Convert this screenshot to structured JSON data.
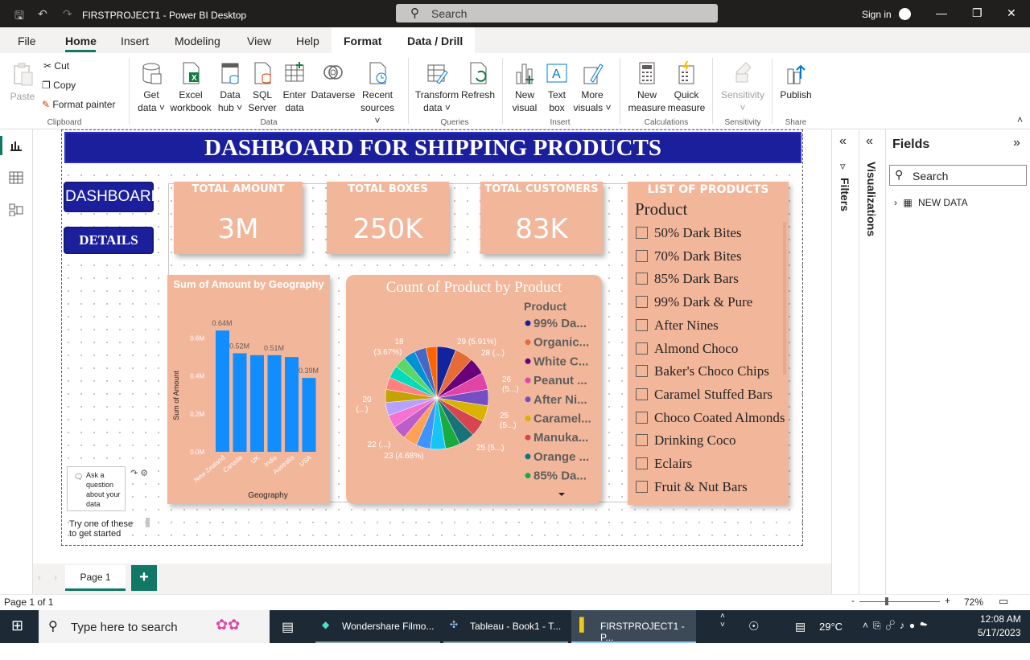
{
  "titlebar": {
    "title": "FIRSTPROJECT1 - Power BI Desktop",
    "search_placeholder": "Search",
    "signin": "Sign in"
  },
  "menu": [
    "File",
    "Home",
    "Insert",
    "Modeling",
    "View",
    "Help",
    "Format",
    "Data / Drill"
  ],
  "ribbon": {
    "paste": "Paste",
    "cut": "Cut",
    "copy": "Copy",
    "format_painter": "Format painter",
    "get_data": "Get data",
    "excel": "Excel workbook",
    "datahub": "Data hub",
    "sql": "SQL Server",
    "enter": "Enter data",
    "dataverse": "Dataverse",
    "recent": "Recent sources",
    "transform": "Transform data",
    "refresh": "Refresh",
    "new_visual": "New visual",
    "text_box": "Text box",
    "more_visuals": "More visuals",
    "new_measure": "New measure",
    "quick_measure": "Quick measure",
    "sensitivity": "Sensitivity",
    "publish": "Publish",
    "groups": {
      "clipboard": "Clipboard",
      "data": "Data",
      "queries": "Queries",
      "insert": "Insert",
      "calculations": "Calculations",
      "sensitivity": "Sensitivity",
      "share": "Share"
    }
  },
  "report": {
    "banner": "DASHBOARD FOR SHIPPING PRODUCTS",
    "nav": {
      "dashboard": "DASHBOARD",
      "details": "DETAILS"
    },
    "cards": [
      {
        "title": "TOTAL AMOUNT",
        "value": "3M"
      },
      {
        "title": "TOTAL BOXES",
        "value": "250K"
      },
      {
        "title": "TOTAL CUSTOMERS",
        "value": "83K"
      }
    ],
    "product_list": {
      "title": "LIST OF PRODUCTS",
      "header": "Product",
      "items": [
        "50% Dark Bites",
        "70% Dark Bites",
        "85% Dark Bars",
        "99% Dark & Pure",
        "After Nines",
        "Almond Choco",
        "Baker's Choco Chips",
        "Caramel Stuffed Bars",
        "Choco Coated Almonds",
        "Drinking Coco",
        "Eclairs",
        "Fruit & Nut Bars"
      ]
    },
    "qa": {
      "text": "Ask a question about your data",
      "hint": "Try one of these to get started"
    }
  },
  "chart_data": [
    {
      "type": "bar",
      "title": "Sum of Amount by Geography",
      "xlabel": "Geography",
      "ylabel": "Sum of Amount",
      "categories": [
        "New Zealand",
        "Canada",
        "UK",
        "India",
        "Australia",
        "USA"
      ],
      "values": [
        0.64,
        0.52,
        0.51,
        0.51,
        0.5,
        0.39
      ],
      "data_labels": [
        "0.64M",
        "0.52M",
        "",
        "0.51M",
        "",
        "0.39M"
      ],
      "yticks": [
        "0.0M",
        "0.2M",
        "0.4M",
        "0.6M"
      ],
      "ylim": [
        0,
        0.7
      ],
      "color": "#118dff"
    },
    {
      "type": "pie",
      "title": "Count of Product by Product",
      "legend_title": "Product",
      "legend": [
        {
          "label": "99% Da...",
          "color": "#12239e"
        },
        {
          "label": "Organic...",
          "color": "#e66c37"
        },
        {
          "label": "White C...",
          "color": "#6b007b"
        },
        {
          "label": "Peanut ...",
          "color": "#e044a7"
        },
        {
          "label": "After Ni...",
          "color": "#744ec2"
        },
        {
          "label": "Caramel...",
          "color": "#d9b300"
        },
        {
          "label": "Manuka...",
          "color": "#d64550"
        },
        {
          "label": "Orange ...",
          "color": "#197278"
        },
        {
          "label": "85% Da...",
          "color": "#1aab40"
        }
      ],
      "slices": [
        29,
        28,
        26,
        26,
        25,
        25,
        25,
        24,
        23,
        23,
        22,
        22,
        21,
        20,
        20,
        20,
        19,
        19,
        18,
        18,
        18,
        17
      ],
      "colors": [
        "#12239e",
        "#e66c37",
        "#6b007b",
        "#e044a7",
        "#744ec2",
        "#d9b300",
        "#d64550",
        "#197278",
        "#1aab40",
        "#15c6f4",
        "#4092ff",
        "#ffa058",
        "#be5dc9",
        "#f472d0",
        "#b5a1ff",
        "#c4a200",
        "#ff8080",
        "#00dbbc",
        "#5bd667",
        "#0091d5",
        "#4668c5",
        "#ff6300"
      ],
      "labels": [
        {
          "text": "29 (5.91%)"
        },
        {
          "text": "28 (...)"
        },
        {
          "text": "26"
        },
        {
          "text": "(5...)"
        },
        {
          "text": "25"
        },
        {
          "text": "(5...)"
        },
        {
          "text": "25 (5...)"
        },
        {
          "text": "23 (4.68%)"
        },
        {
          "text": "22 (...)"
        },
        {
          "text": "20"
        },
        {
          "text": "(...)"
        },
        {
          "text": "18"
        },
        {
          "text": "(3.67%)"
        }
      ]
    }
  ],
  "right": {
    "filters": "Filters",
    "visualizations": "Visualizations",
    "fields": "Fields",
    "search": "Search",
    "table": "NEW DATA"
  },
  "pages": {
    "page1": "Page 1",
    "status": "Page 1 of 1",
    "zoom": "72%"
  },
  "taskbar": {
    "search": "Type here to search",
    "apps": [
      "Wondershare Filmo...",
      "Tableau - Book1 - T...",
      "FIRSTPROJECT1 - P..."
    ],
    "temp": "29°C",
    "time": "12:08 AM",
    "date": "5/17/2023"
  }
}
